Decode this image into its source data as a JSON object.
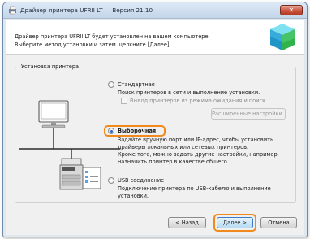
{
  "window": {
    "title": "Драйвер принтера UFRII LT — Версия 21.10",
    "close_glyph": "✕"
  },
  "intro": {
    "line1": "Драйвер принтера UFRII LT будет установлен на вашем компьютере.",
    "line2": "Выберите метод установки и затем щелкните [Далее]."
  },
  "group": {
    "label": "Установка принтера"
  },
  "options": {
    "standard": {
      "label": "Стандартная",
      "desc": [
        "Поиск принтеров в сети и выполнение установки."
      ],
      "checkbox_label": "Вывод принтеров из режима ожидания и поиск",
      "advanced_button": "Расширенные настройки..."
    },
    "custom": {
      "label": "Выборочная",
      "selected": true,
      "desc": [
        "Задайте вручную порт или IP-адрес, чтобы установить",
        "драйверы локальных или сетевых принтеров.",
        "Кроме того, можно задать другие настройки, например,",
        "назначить принтер в качестве общего."
      ]
    },
    "usb": {
      "label": "USB соединение",
      "desc": [
        "Подключение принтера по USB-кабелю и выполнение",
        "установки."
      ]
    }
  },
  "buttons": {
    "back": "< Назад",
    "next": "Далее >",
    "cancel": "Отмена"
  },
  "colors": {
    "highlight": "#f08a1d",
    "accent": "#2a63c7"
  },
  "icons": {
    "title": "printer-driver-icon",
    "header": "installer-cube-icon",
    "computer": "computer-icon",
    "printer": "printer-icon",
    "document": "document-icon"
  }
}
